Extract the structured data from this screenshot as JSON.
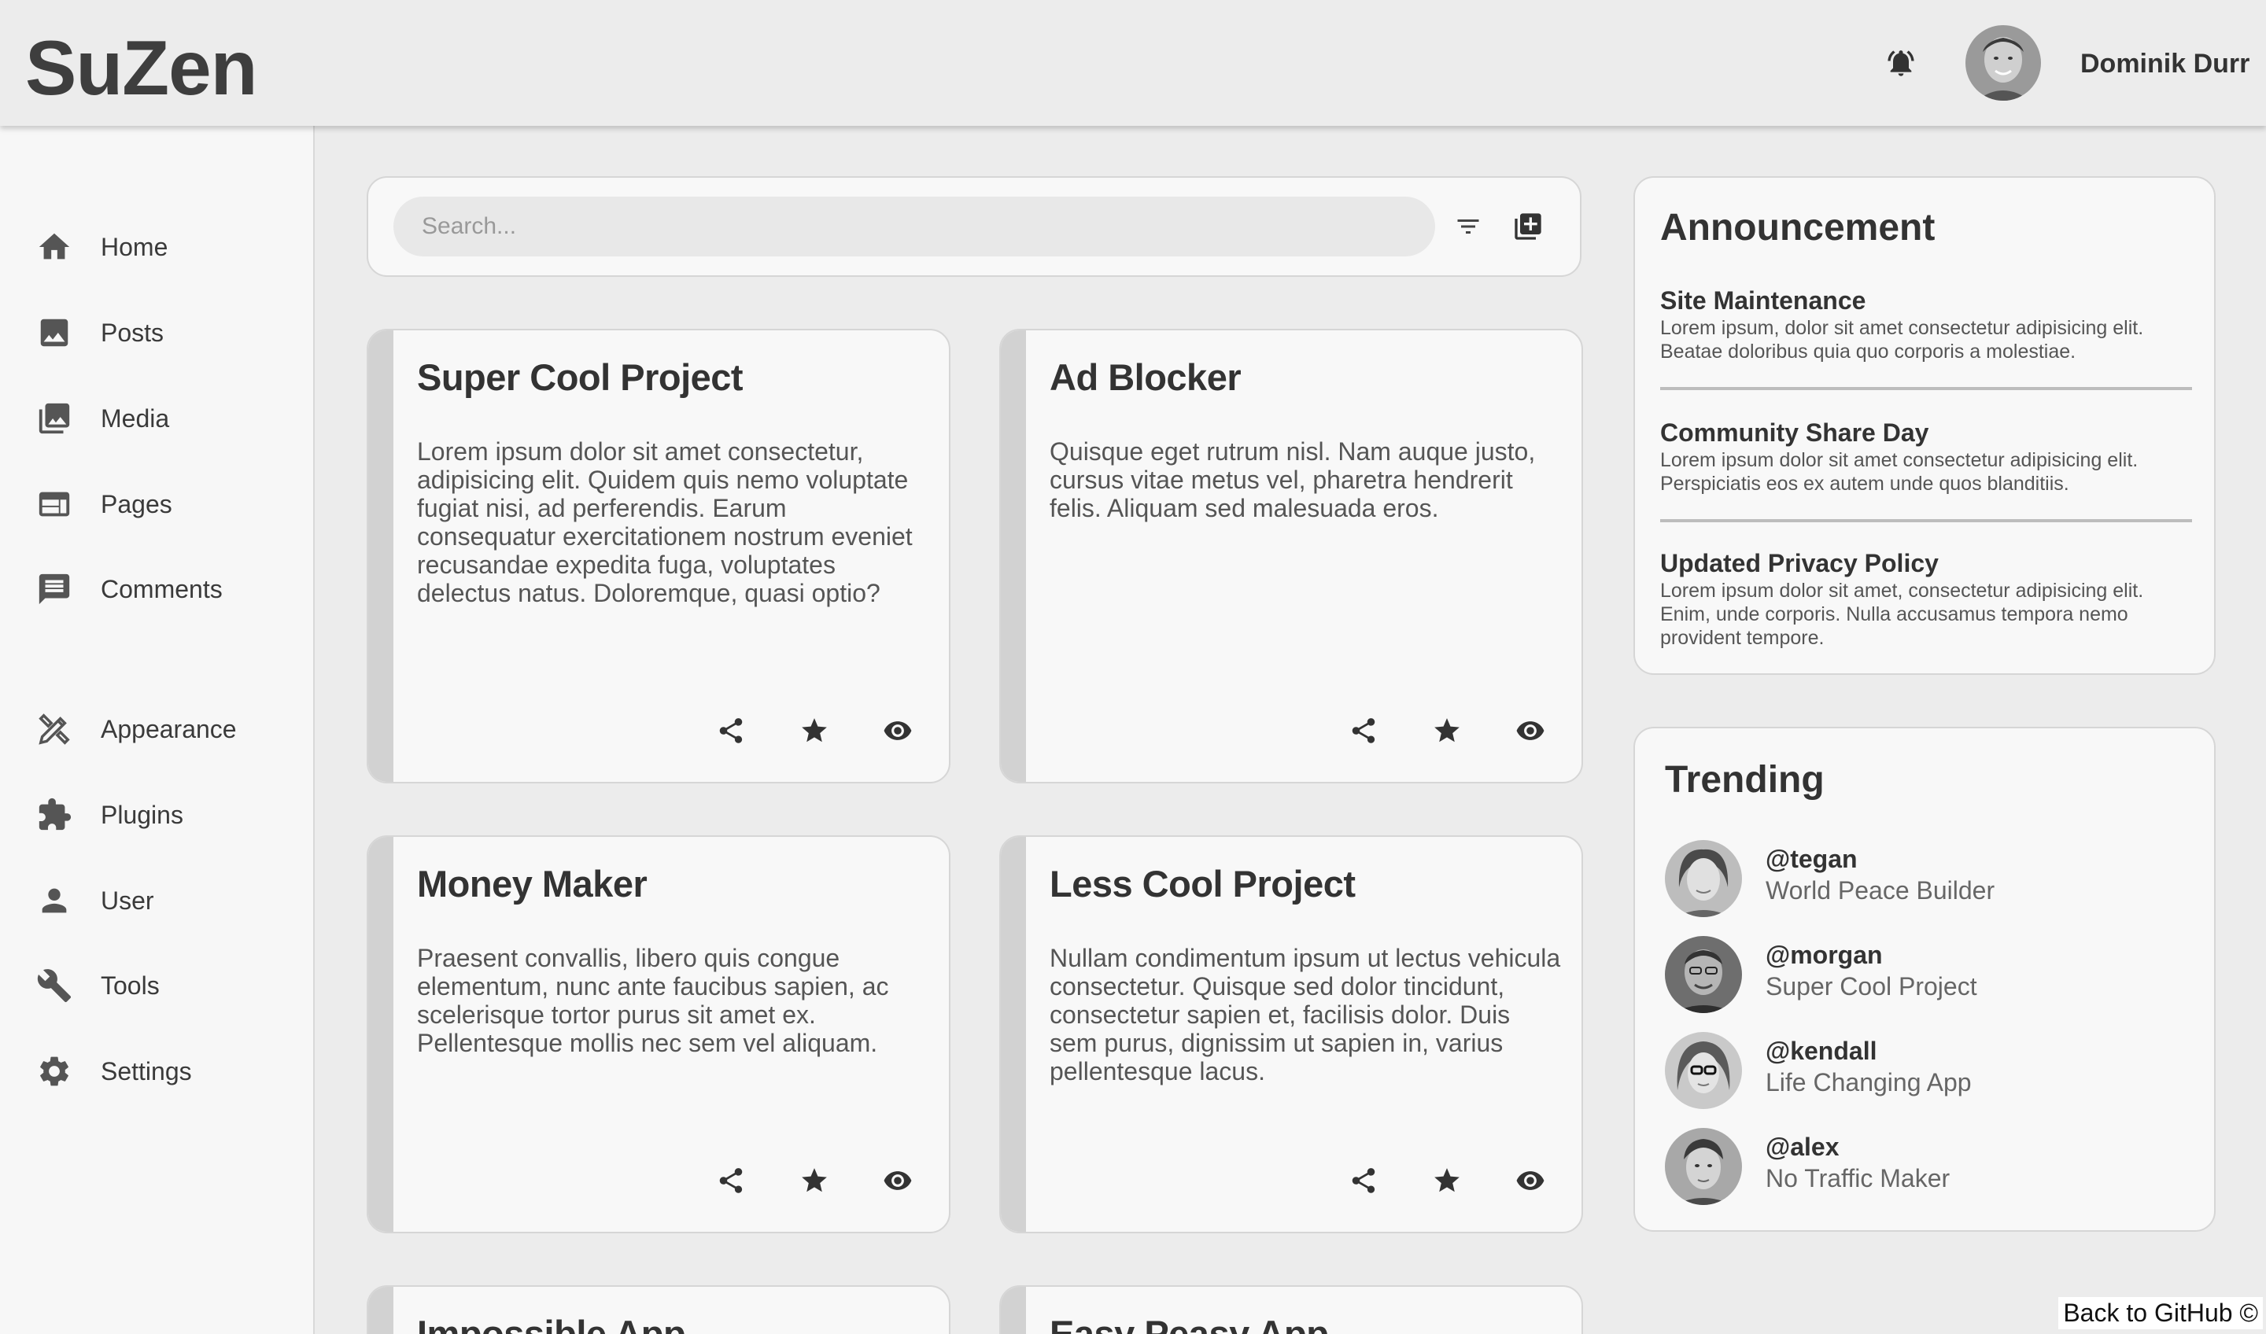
{
  "header": {
    "logo": "SuZen",
    "user_name": "Dominik Durr",
    "icons": {
      "notifications": "bell-icon",
      "avatar": "user-avatar"
    }
  },
  "sidebar": {
    "items": [
      {
        "label": "Home",
        "icon": "home-icon"
      },
      {
        "label": "Posts",
        "icon": "image-icon"
      },
      {
        "label": "Media",
        "icon": "photo-library-icon"
      },
      {
        "label": "Pages",
        "icon": "web-page-icon"
      },
      {
        "label": "Comments",
        "icon": "comment-icon"
      },
      {
        "label": "Appearance",
        "icon": "design-tools-icon"
      },
      {
        "label": "Plugins",
        "icon": "puzzle-icon"
      },
      {
        "label": "User",
        "icon": "person-icon"
      },
      {
        "label": "Tools",
        "icon": "wrench-icon"
      },
      {
        "label": "Settings",
        "icon": "gear-icon"
      }
    ]
  },
  "search": {
    "placeholder": "Search...",
    "value": "",
    "icons": {
      "filter": "filter-icon",
      "add": "library-add-icon"
    }
  },
  "projects": [
    {
      "title": "Super Cool Project",
      "body": "Lorem ipsum dolor sit amet consectetur, adipisicing elit. Quidem quis nemo voluptate fugiat nisi, ad perferendis. Earum consequatur exercitationem nostrum eveniet recusandae expedita fuga, voluptates delectus natus. Doloremque, quasi optio?"
    },
    {
      "title": "Ad Blocker",
      "body": "Quisque eget rutrum nisl. Nam auque justo, cursus vitae metus vel, pharetra hendrerit felis. Aliquam sed malesuada eros."
    },
    {
      "title": "Money Maker",
      "body": "Praesent convallis, libero quis congue elementum, nunc ante faucibus sapien, ac scelerisque tortor purus sit amet ex. Pellentesque mollis nec sem vel aliquam."
    },
    {
      "title": "Less Cool Project",
      "body": "Nullam condimentum ipsum ut lectus vehicula consectetur. Quisque sed dolor tincidunt, consectetur sapien et, facilisis dolor. Duis sem purus, dignissim ut sapien in, varius pellentesque lacus."
    },
    {
      "title": "Impossible App",
      "body": ""
    },
    {
      "title": "Easy Peasy App",
      "body": ""
    }
  ],
  "card_action_icons": [
    "share-icon",
    "star-icon",
    "eye-icon"
  ],
  "announcement": {
    "title": "Announcement",
    "items": [
      {
        "heading": "Site Maintenance",
        "text": "Lorem ipsum, dolor sit amet consectetur adipisicing elit. Beatae doloribus quia quo corporis a molestiae."
      },
      {
        "heading": "Community Share Day",
        "text": "Lorem ipsum dolor sit amet consectetur adipisicing elit. Perspiciatis eos ex autem unde quos blanditiis."
      },
      {
        "heading": "Updated Privacy Policy",
        "text": "Lorem ipsum dolor sit amet, consectetur adipisicing elit. Enim, unde corporis. Nulla accusamus tempora nemo provident tempore."
      }
    ]
  },
  "trending": {
    "title": "Trending",
    "items": [
      {
        "handle": "@tegan",
        "project": "World Peace Builder"
      },
      {
        "handle": "@morgan",
        "project": "Super Cool Project"
      },
      {
        "handle": "@kendall",
        "project": "Life Changing App"
      },
      {
        "handle": "@alex",
        "project": "No Traffic Maker"
      }
    ]
  },
  "footer": {
    "github_link": "Back to GitHub ©"
  },
  "colors": {
    "background": "#ececec",
    "card": "#f8f8f8",
    "card_accent": "#d2d2d2",
    "text": "#333333"
  }
}
